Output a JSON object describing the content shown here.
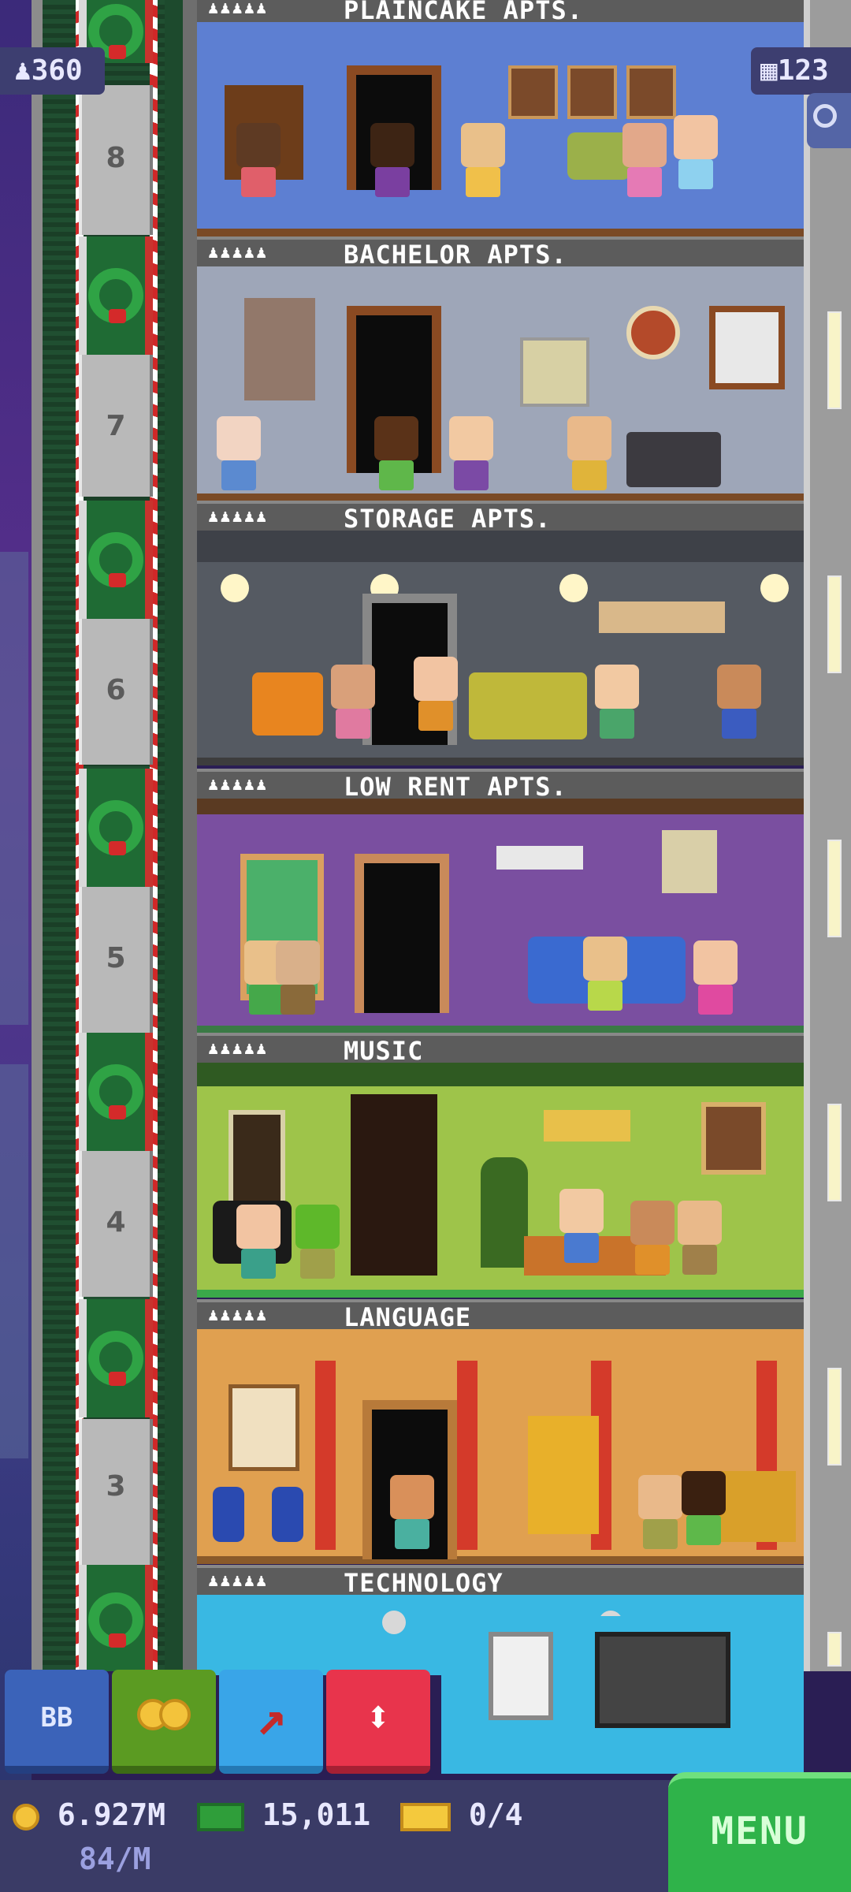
{
  "stats": {
    "population": "360",
    "floors_count": "123"
  },
  "elevator": {
    "floor_numbers": [
      "8",
      "7",
      "6",
      "5",
      "4",
      "3"
    ]
  },
  "floors": [
    {
      "name": "PLAINCAKE APTS.",
      "people": "♟♟♟♟♟"
    },
    {
      "name": "BACHELOR APTS.",
      "people": "♟♟♟♟♟"
    },
    {
      "name": "STORAGE APTS.",
      "people": "♟♟♟♟♟"
    },
    {
      "name": "LOW RENT APTS.",
      "people": "♟♟♟♟♟"
    },
    {
      "name": "MUSIC",
      "people": "♟♟♟♟♟"
    },
    {
      "name": "LANGUAGE",
      "people": "♟♟♟♟♟"
    },
    {
      "name": "TECHNOLOGY",
      "people": "♟♟♟♟♟"
    }
  ],
  "toolbar": {
    "bb_label": "BB"
  },
  "bottom_bar": {
    "coins": "6.927M",
    "coin_rate": "84/M",
    "bux_cash": "15,011",
    "tickets": "0/4",
    "menu_label": "MENU"
  },
  "colors": {
    "accent_menu": "#2fb34a",
    "bar_bg": "#3a3b66"
  }
}
